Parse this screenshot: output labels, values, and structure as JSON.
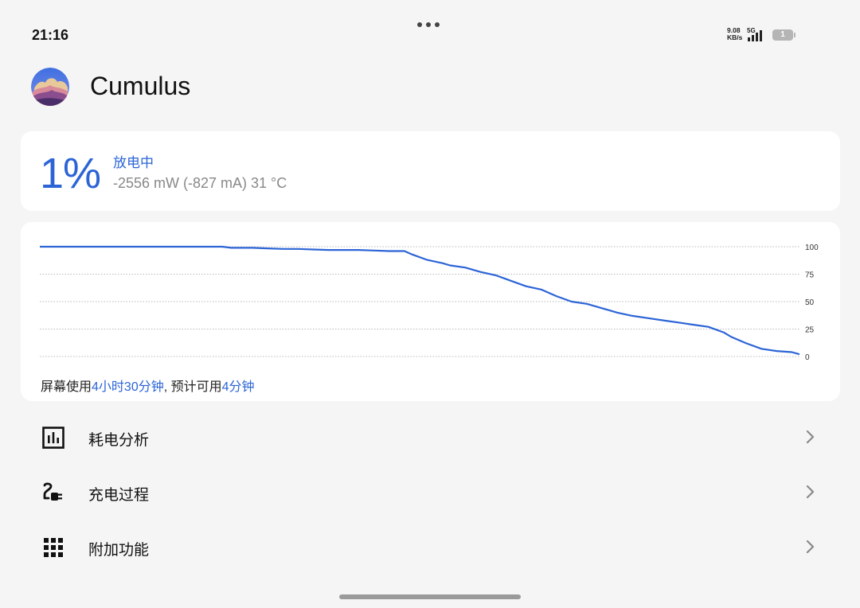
{
  "status_bar": {
    "time": "21:16",
    "net_speed_value": "9.08",
    "net_speed_unit": "KB/s",
    "network_type": "5G",
    "battery_level": "1"
  },
  "app": {
    "title": "Cumulus",
    "logo_icon": "cumulus-logo-icon"
  },
  "battery": {
    "percent": "1%",
    "state": "放电中",
    "detail": "-2556 mW (-827 mA) 31 °C",
    "accent": "#2c64d6"
  },
  "usage": {
    "prefix": "屏幕使用",
    "screen_time": "4小时30分钟",
    "middle": ", 预计可用",
    "remaining": "4分钟"
  },
  "chart_data": {
    "type": "line",
    "ylim": [
      0,
      100
    ],
    "y_ticks": [
      "100",
      "75",
      "50",
      "25",
      "0"
    ],
    "grid": true,
    "series": [
      {
        "color": "#2c64d6",
        "x": [
          0,
          4,
          8,
          12,
          16,
          20,
          24,
          25.2,
          26,
          28,
          30,
          32,
          34,
          36,
          38,
          40,
          42,
          44,
          46,
          48,
          49,
          51,
          53,
          54,
          56,
          58,
          60,
          62,
          64,
          66,
          68,
          70,
          72,
          74,
          76,
          78,
          80,
          82,
          84,
          86,
          88,
          90,
          91,
          93,
          95,
          97,
          99,
          100
        ],
        "y": [
          100,
          100,
          100,
          100,
          100,
          100,
          100,
          99,
          99,
          99,
          98.5,
          98,
          98,
          97.5,
          97,
          97,
          97,
          96.5,
          96,
          96,
          93,
          88,
          85,
          83,
          81,
          77,
          74,
          69,
          64,
          61,
          55,
          50,
          48,
          44,
          40,
          37,
          35,
          33,
          31,
          29,
          27,
          22,
          18,
          12,
          7,
          5,
          4,
          2
        ]
      }
    ]
  },
  "menu": [
    {
      "label": "耗电分析",
      "icon": "bar-chart-icon"
    },
    {
      "label": "充电过程",
      "icon": "charging-plug-icon"
    },
    {
      "label": "附加功能",
      "icon": "grid-apps-icon"
    }
  ]
}
